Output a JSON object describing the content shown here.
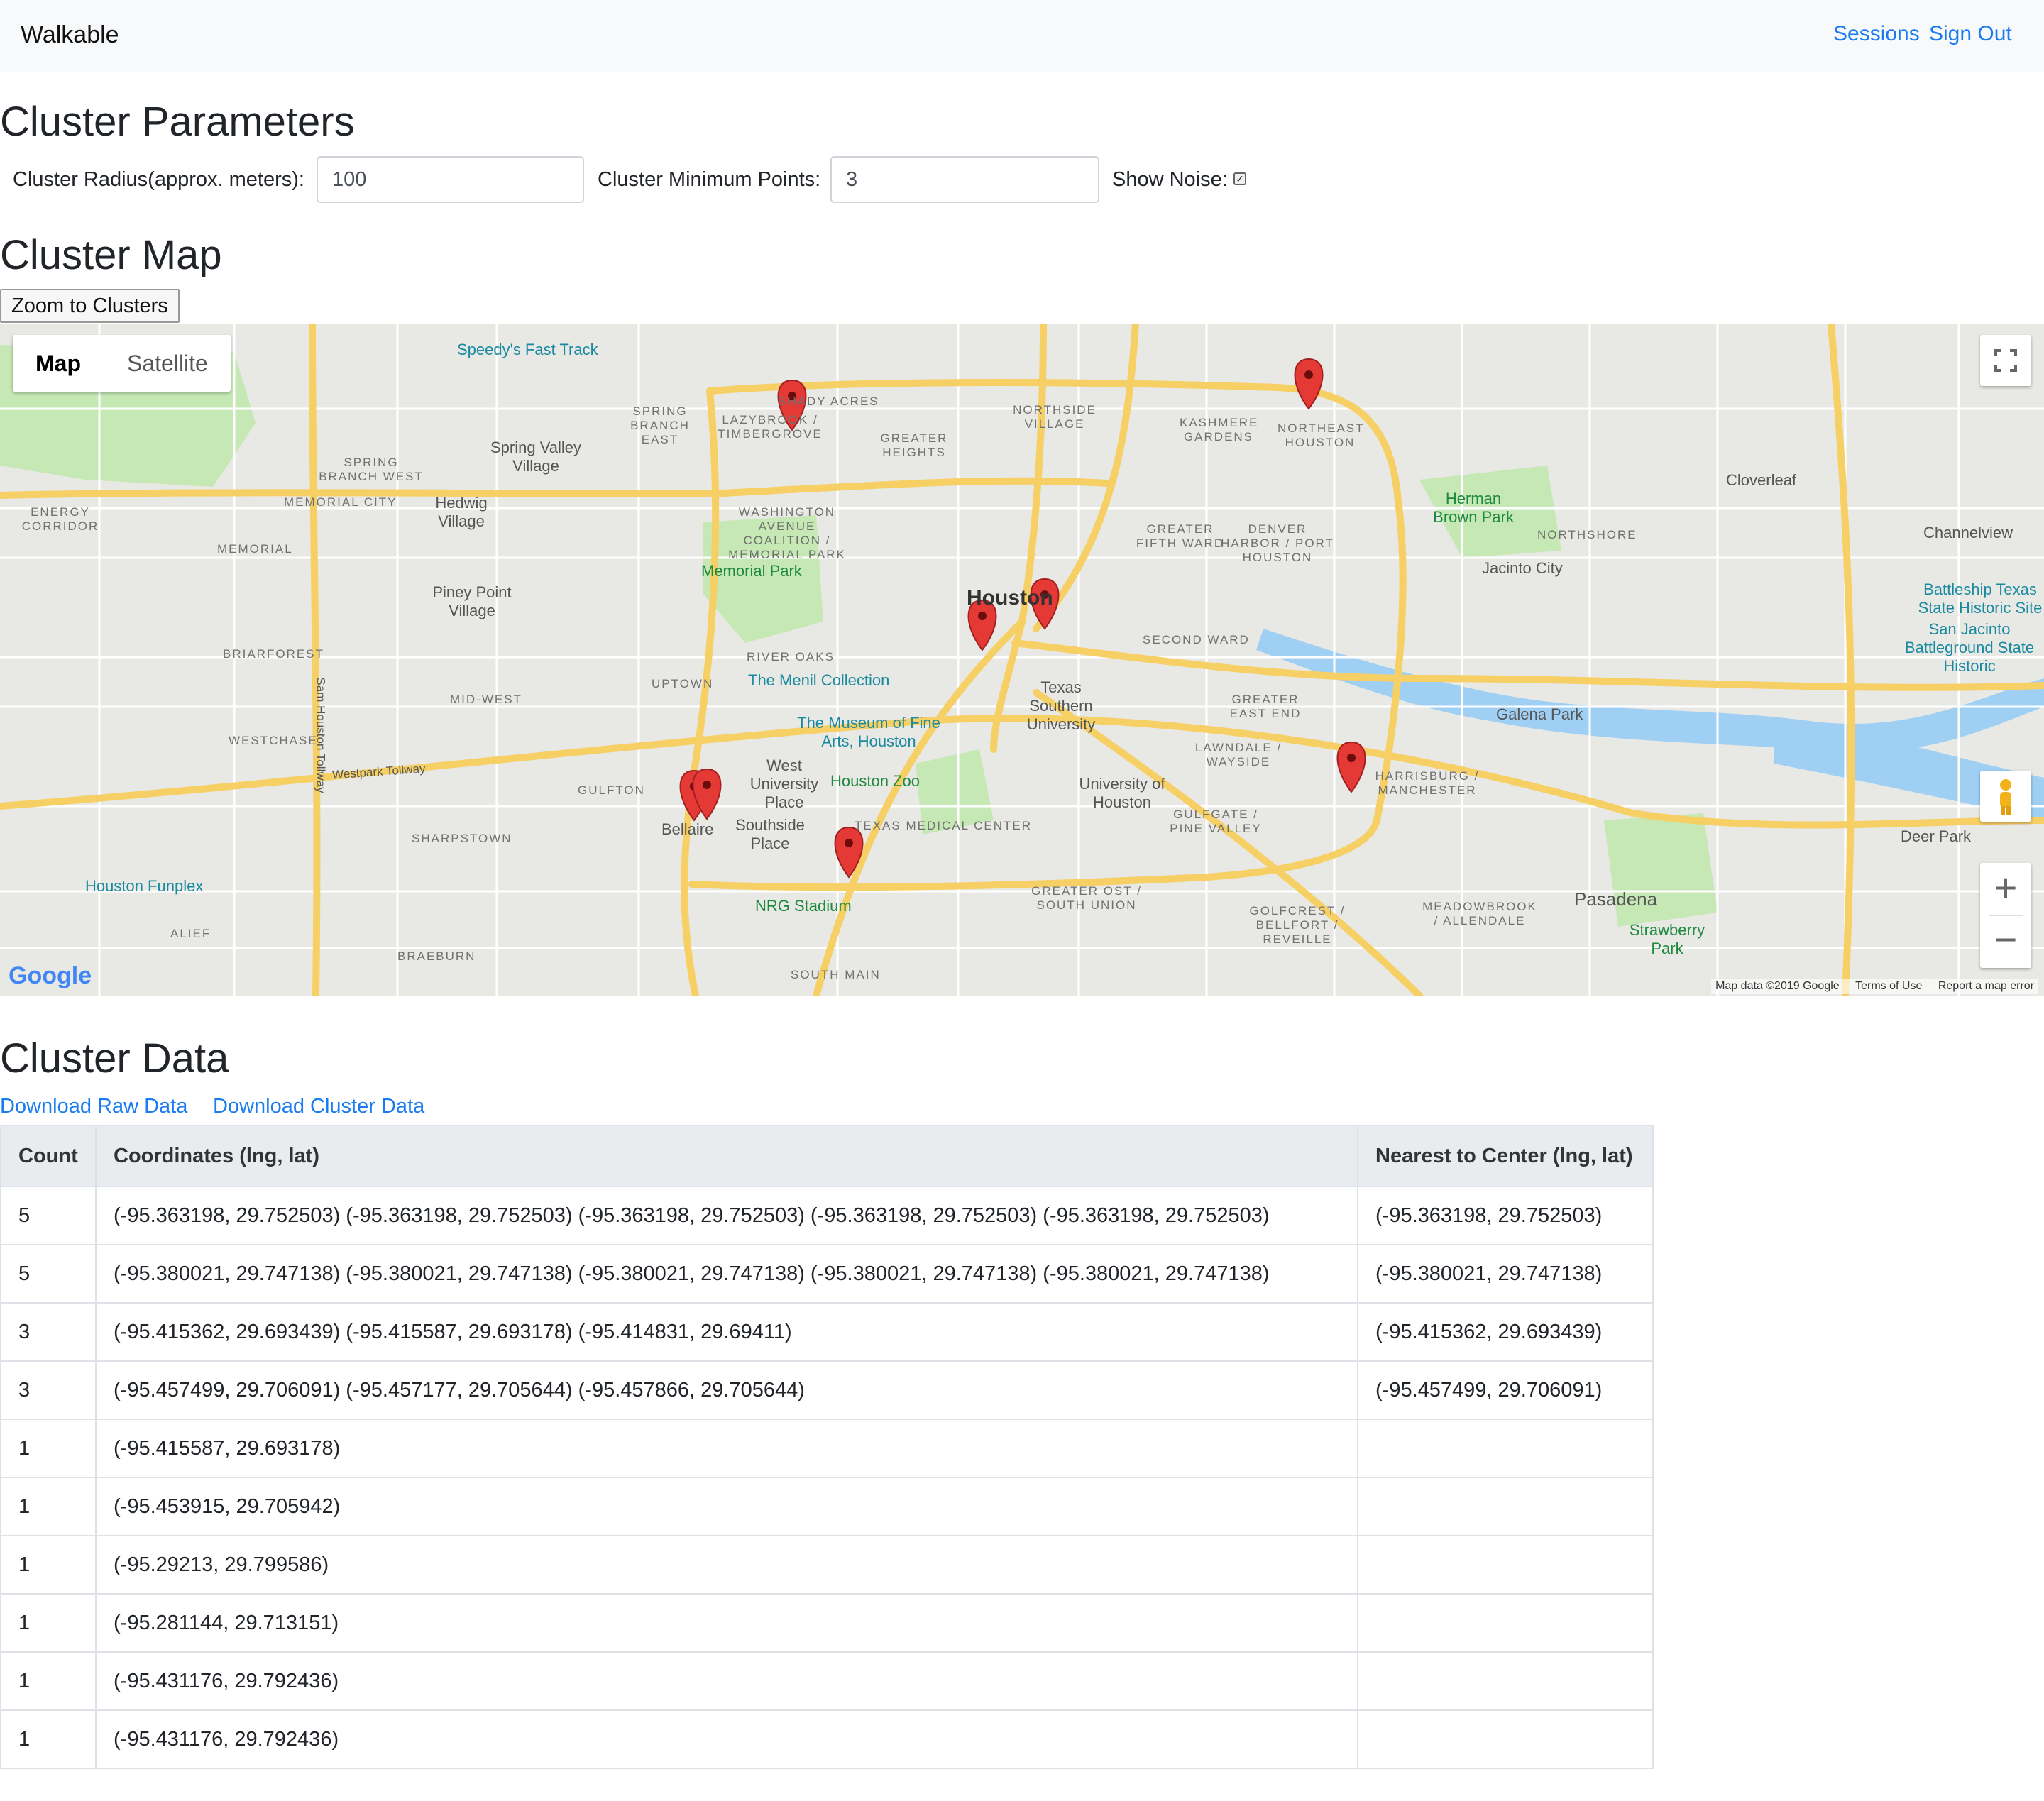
{
  "nav": {
    "brand": "Walkable",
    "sessions": "Sessions",
    "sign_out": "Sign Out"
  },
  "params": {
    "title": "Cluster Parameters",
    "radius_label": "Cluster Radius(approx. meters):",
    "radius_value": "100",
    "min_points_label": "Cluster Minimum Points:",
    "min_points_value": "3",
    "show_noise_label": "Show Noise:",
    "show_noise_checked": true
  },
  "map_section": {
    "title": "Cluster Map",
    "zoom_button": "Zoom to Clusters",
    "map_type": {
      "map": "Map",
      "satellite": "Satellite"
    },
    "google": "Google",
    "attribution": {
      "data": "Map data ©2019 Google",
      "terms": "Terms of Use",
      "report": "Report a map error"
    },
    "labels": {
      "houston": "Houston",
      "bellaire": "Bellaire",
      "pasadena": "Pasadena",
      "memorial_park": "Memorial Park",
      "menil": "The Menil Collection",
      "museum": "The Museum of Fine Arts, Houston",
      "zoo": "Houston Zoo",
      "nrg": "NRG Stadium",
      "tsu": "Texas Southern University",
      "uh": "University of Houston",
      "speedy": "Speedy's Fast Track",
      "funplex": "Houston Funplex",
      "herman": "Herman Brown Park",
      "cloverleaf": "Cloverleaf",
      "channelview": "Channelview",
      "jacinto": "Jacinto City",
      "galena": "Galena Park",
      "deer_park": "Deer Park",
      "hedwig": "Hedwig Village",
      "spring_valley": "Spring Valley Village",
      "piney_point": "Piney Point Village",
      "wup": "West University Place",
      "southside": "Southside Place",
      "strawberry": "Strawberry Park",
      "battleship": "Battleship Texas State Historic Site",
      "san_jacinto": "San Jacinto Battleground State Historic",
      "westpark": "Westpark Tollway",
      "sam_houston": "Sam Houston Tollway",
      "uptown": "UPTOWN",
      "river_oaks": "RIVER OAKS",
      "gulfton": "GULFTON",
      "sharpstown": "SHARPSTOWN",
      "westchase": "WESTCHASE",
      "briarforest": "BRIARFOREST",
      "mid_west": "MID-WEST",
      "alief": "ALIEF",
      "braeburn": "BRAEBURN",
      "south_main": "SOUTH MAIN",
      "second_ward": "SECOND WARD",
      "northshore": "NORTHSHORE",
      "kashmere": "KASHMERE GARDENS",
      "northeast": "NORTHEAST HOUSTON",
      "greater_heights": "GREATER HEIGHTS",
      "northside": "NORTHSIDE VILLAGE",
      "medical": "TEXAS MEDICAL CENTER",
      "memorial": "MEMORIAL",
      "memorial_city": "MEMORIAL CITY",
      "energy": "ENERGY CORRIDOR",
      "spring_branch_east": "SPRING BRANCH EAST",
      "spring_branch_west": "SPRING BRANCH WEST",
      "shady_acres": "SHADY ACRES",
      "lazybrook": "LAZYBROOK / TIMBERGROVE",
      "washington": "WASHINGTON AVENUE COALITION / MEMORIAL PARK",
      "fifth_ward": "GREATER FIFTH WARD",
      "denver": "DENVER HARBOR / PORT HOUSTON",
      "greater_east_end": "GREATER EAST END",
      "lawndale": "LAWNDALE / WAYSIDE",
      "harrisburg": "HARRISBURG / MANCHESTER",
      "gulfgate": "GULFGATE / PINE VALLEY",
      "greater_ost": "GREATER OST / SOUTH UNION",
      "golfcrest": "GOLFCREST / BELLFORT / REVEILLE",
      "meadowbrook": "MEADOWBROOK / ALLENDALE"
    }
  },
  "data_section": {
    "title": "Cluster Data",
    "download_raw": "Download Raw Data",
    "download_cluster": "Download Cluster Data",
    "headers": [
      "Count",
      "Coordinates (lng, lat)",
      "Nearest to Center (lng, lat)"
    ],
    "rows": [
      [
        "5",
        "(-95.363198, 29.752503) (-95.363198, 29.752503) (-95.363198, 29.752503) (-95.363198, 29.752503) (-95.363198, 29.752503)",
        "(-95.363198, 29.752503)"
      ],
      [
        "5",
        "(-95.380021, 29.747138) (-95.380021, 29.747138) (-95.380021, 29.747138) (-95.380021, 29.747138) (-95.380021, 29.747138)",
        "(-95.380021, 29.747138)"
      ],
      [
        "3",
        "(-95.415362, 29.693439) (-95.415587, 29.693178) (-95.414831, 29.69411)",
        "(-95.415362, 29.693439)"
      ],
      [
        "3",
        "(-95.457499, 29.706091) (-95.457177, 29.705644) (-95.457866, 29.705644)",
        "(-95.457499, 29.706091)"
      ],
      [
        "1",
        "(-95.415587, 29.693178)",
        ""
      ],
      [
        "1",
        "(-95.453915, 29.705942)",
        ""
      ],
      [
        "1",
        "(-95.29213, 29.799586)",
        ""
      ],
      [
        "1",
        "(-95.281144, 29.713151)",
        ""
      ],
      [
        "1",
        "(-95.431176, 29.792436)",
        ""
      ],
      [
        "1",
        "(-95.431176, 29.792436)",
        ""
      ]
    ]
  },
  "colors": {
    "link": "#1a7cf0",
    "marker": "#e53935",
    "highway": "#f6cf65",
    "park": "#c6e8b5",
    "water": "#9fd0f4"
  }
}
